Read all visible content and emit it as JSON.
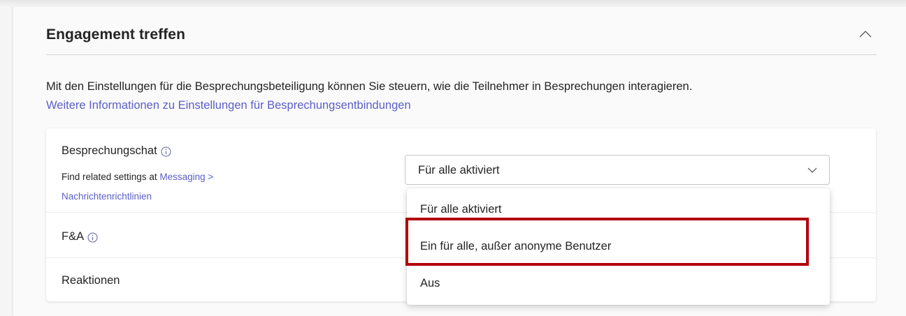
{
  "section": {
    "title": "Engagement treffen",
    "collapse_icon": "chevron-up-icon",
    "description": "Mit den Einstellungen für die Besprechungsbeteiligung können Sie steuern, wie die Teilnehmer in Besprechungen interagieren.",
    "learn_more_link": "Weitere Informationen zu Einstellungen für Besprechungsentbindungen"
  },
  "settings": {
    "meeting_chat": {
      "label": "Besprechungschat",
      "info_icon": "info-icon",
      "related_prefix": "Find related settings at ",
      "related_link_1": "Messaging >",
      "related_link_2": "Nachrichtenrichtlinien"
    },
    "qa": {
      "label": "F&A",
      "info_icon": "info-icon"
    },
    "reactions": {
      "label": "Reaktionen"
    }
  },
  "dropdown": {
    "selected": "Für alle aktiviert",
    "options": [
      "Für alle aktiviert",
      "Ein für alle, außer anonyme Benutzer",
      "Aus"
    ],
    "highlighted_option_index": 1
  },
  "colors": {
    "accent": "#5b5fc7",
    "highlight": "#b3000c"
  }
}
